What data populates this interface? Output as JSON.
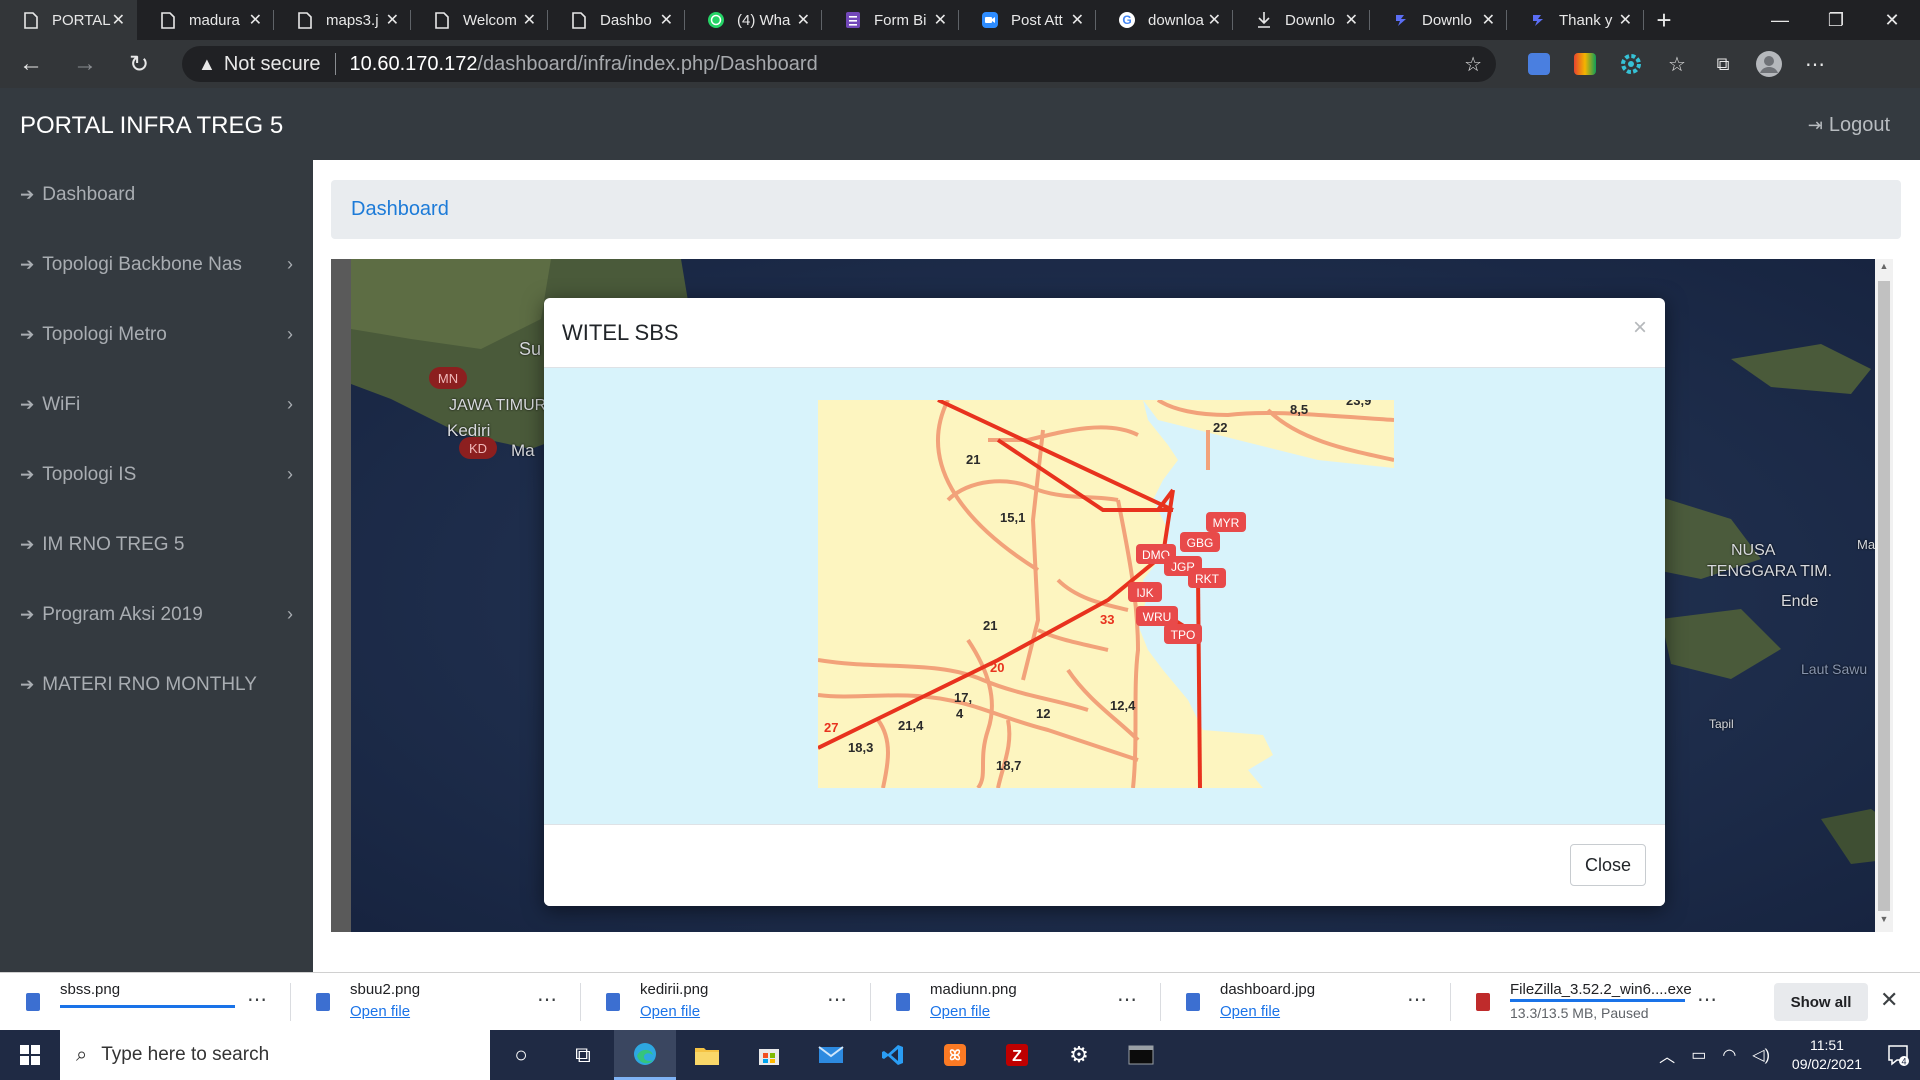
{
  "browser": {
    "tabs": [
      {
        "title": "PORTAL",
        "icon": "page-icon",
        "active": true
      },
      {
        "title": "madura",
        "icon": "page-icon"
      },
      {
        "title": "maps3.j",
        "icon": "page-icon"
      },
      {
        "title": "Welcom",
        "icon": "page-icon"
      },
      {
        "title": "Dashbo",
        "icon": "page-icon"
      },
      {
        "title": "(4) Wha",
        "icon": "whatsapp-icon"
      },
      {
        "title": "Form Bi",
        "icon": "forms-icon"
      },
      {
        "title": "Post Att",
        "icon": "zoom-icon"
      },
      {
        "title": "downloa",
        "icon": "google-icon"
      },
      {
        "title": "Downlo",
        "icon": "download-icon"
      },
      {
        "title": "Downlo",
        "icon": "app-icon"
      },
      {
        "title": "Thank y",
        "icon": "app-icon"
      }
    ],
    "new_tab": "+",
    "address": {
      "warning": "Not secure",
      "host": "10.60.170.172",
      "path": "/dashboard/infra/index.php/Dashboard"
    }
  },
  "app": {
    "brand": "PORTAL INFRA TREG 5",
    "logout": "Logout",
    "sidebar": [
      {
        "label": "Dashboard",
        "has_children": false
      },
      {
        "label": "Topologi Backbone Nas",
        "has_children": true
      },
      {
        "label": "Topologi Metro",
        "has_children": true
      },
      {
        "label": "WiFi",
        "has_children": true
      },
      {
        "label": "Topologi IS",
        "has_children": true
      },
      {
        "label": "IM RNO TREG 5",
        "has_children": false
      },
      {
        "label": "Program Aksi 2019",
        "has_children": true
      },
      {
        "label": "MATERI RNO MONTHLY",
        "has_children": false
      }
    ],
    "sidebar_toggle": "‹",
    "breadcrumb": "Dashboard",
    "map_labels": {
      "su": "Su",
      "jawa_timur": "JAWA TIMUR",
      "kediri": "Kediri",
      "ma": "Ma",
      "nusa_tenggara": "NUSA",
      "tenggara_tim": "TENGGARA TIM.",
      "ende": "Ende",
      "laut_sawu": "Laut Sawu",
      "tapil": "Tapil",
      "ma_right": "Ma"
    },
    "map_markers": [
      "MN",
      "KD"
    ]
  },
  "modal": {
    "title": "WITEL SBS",
    "close_x": "×",
    "close_button": "Close",
    "map": {
      "road_labels": [
        "21",
        "15,1",
        "21",
        "20",
        "27",
        "18,3",
        "21,4",
        "17,",
        "4",
        "12",
        "12,4",
        "18,7",
        "22",
        "8,5",
        "23,9",
        "33"
      ],
      "sites": [
        "MYR",
        "GBG",
        "DMO",
        "JGR",
        "RKT",
        "IJK",
        "WRU",
        "TPO"
      ],
      "colors": {
        "land": "#fdf5c0",
        "sea": "#d8f3fb",
        "road": "#f2a27a",
        "backbone": "#e8321e",
        "site": "#e84a4a"
      }
    }
  },
  "downloads": [
    {
      "name": "sbss.png",
      "status": "",
      "progress": 1.0
    },
    {
      "name": "sbuu2.png",
      "status": "Open file"
    },
    {
      "name": "kedirii.png",
      "status": "Open file"
    },
    {
      "name": "madiunn.png",
      "status": "Open file"
    },
    {
      "name": "dashboard.jpg",
      "status": "Open file"
    },
    {
      "name": "FileZilla_3.52.2_win6....exe",
      "status": "13.3/13.5 MB, Paused",
      "progress": 0.985
    }
  ],
  "downloads_show_all": "Show all",
  "taskbar": {
    "search_placeholder": "Type here to search",
    "time": "11:51",
    "date": "09/02/2021",
    "notifications": "4"
  }
}
